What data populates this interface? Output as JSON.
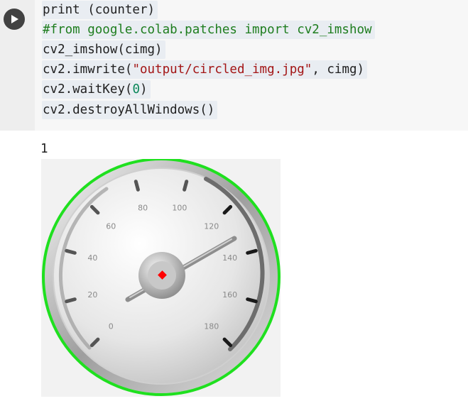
{
  "notebook": {
    "run_button_icon": "play-icon",
    "code_lines": [
      {
        "parts": [
          {
            "text": "print (counter)",
            "kind": "plain"
          }
        ]
      },
      {
        "parts": [
          {
            "text": "#from google.colab.patches import cv2_imshow",
            "kind": "comment"
          }
        ]
      },
      {
        "parts": [
          {
            "text": "cv2_imshow(cimg)",
            "kind": "plain"
          }
        ]
      },
      {
        "parts": [
          {
            "text": "cv2.imwrite(",
            "kind": "plain"
          },
          {
            "text": "\"output/circled_img.jpg\"",
            "kind": "str"
          },
          {
            "text": ", cimg)",
            "kind": "plain"
          }
        ]
      },
      {
        "parts": [
          {
            "text": "cv2.waitKey(",
            "kind": "plain"
          },
          {
            "text": "0",
            "kind": "num"
          },
          {
            "text": ")",
            "kind": "plain"
          }
        ]
      },
      {
        "parts": [
          {
            "text": "cv2.destroyAllWindows()",
            "kind": "plain"
          }
        ]
      }
    ],
    "output_text": "1"
  },
  "gauge_image": {
    "tick_labels": [
      "40",
      "60",
      "80",
      "100",
      "120",
      "140",
      "160",
      "180",
      "20",
      "0"
    ],
    "detected_circle_color": "#1fe01f",
    "center_marker_color": "#ff0000"
  },
  "colors": {
    "cell_bg": "#f7f7f7",
    "gutter_bg": "#eeeeee",
    "run_button": "#424242",
    "comment": "#1e7d1e",
    "string": "#a31515",
    "number": "#098658"
  }
}
